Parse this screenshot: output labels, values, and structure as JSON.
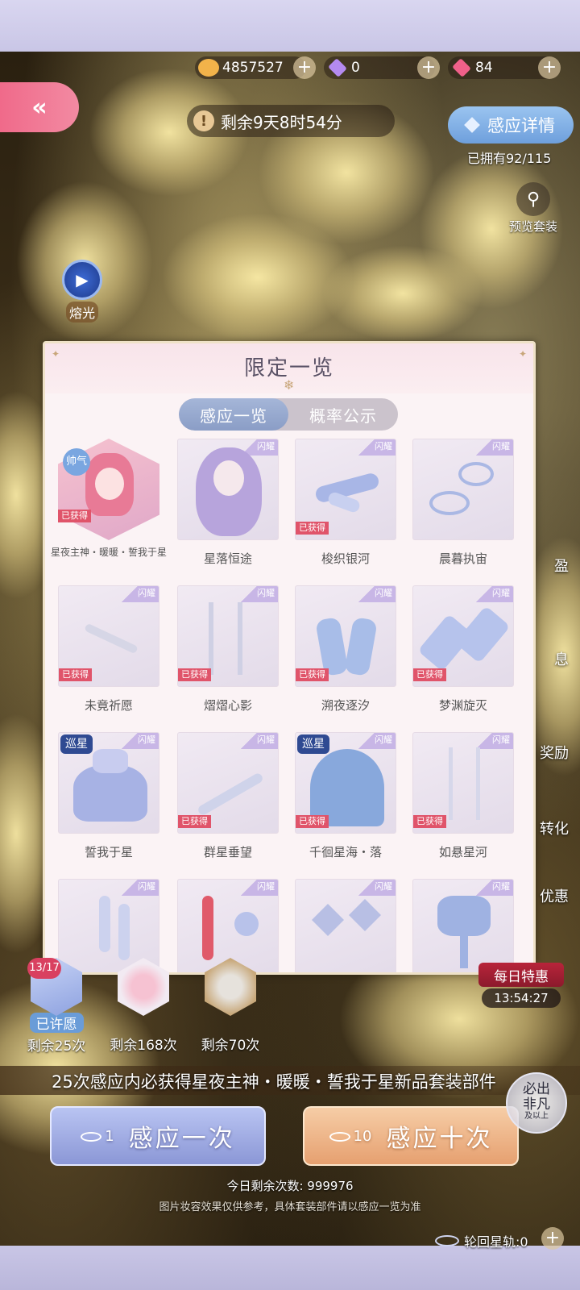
{
  "currency": {
    "gold": "4857527",
    "diamond": "0",
    "gem": "84",
    "gold_color": "#f2b34a",
    "diamond_color": "#b48af0",
    "gem_color": "#f0608a"
  },
  "header": {
    "back_label": "«",
    "timer_icon": "!",
    "timer": "剩余9天8时54分",
    "detail_button": "感应详情",
    "owned": "已拥有92/115",
    "preview_label": "预览套装",
    "play_label": "熔光"
  },
  "side_fragments": [
    "盈",
    "息",
    "奖励",
    "转化",
    "优惠"
  ],
  "panel": {
    "title": "限定一览",
    "tabs": [
      "感应一览",
      "概率公示"
    ],
    "corner_tag": "闪耀",
    "got_label": "已获得",
    "items": [
      {
        "name": "星夜主神・暖暖・誓我于星",
        "got": true,
        "special": true,
        "rarity": "帅气"
      },
      {
        "name": "星落恒途",
        "got": false
      },
      {
        "name": "梭织银河",
        "got": true
      },
      {
        "name": "晨暮执宙",
        "got": false
      },
      {
        "name": "未竟祈愿",
        "got": true
      },
      {
        "name": "熠熠心影",
        "got": true
      },
      {
        "name": "溯夜逐汐",
        "got": true
      },
      {
        "name": "梦渊旋灭",
        "got": true
      },
      {
        "name": "誓我于星",
        "got": false,
        "rarity": "巡星"
      },
      {
        "name": "群星垂望",
        "got": true
      },
      {
        "name": "千徊星海・落",
        "got": true,
        "rarity": "巡星"
      },
      {
        "name": "如悬星河",
        "got": true
      },
      {
        "name": "",
        "got": false
      },
      {
        "name": "",
        "got": false
      },
      {
        "name": "",
        "got": false
      },
      {
        "name": "",
        "got": false
      }
    ]
  },
  "pools": [
    {
      "badge": "13/17",
      "wished": "已许愿",
      "count": "剩余25次"
    },
    {
      "count": "剩余168次"
    },
    {
      "count": "剩余70次"
    }
  ],
  "daily": {
    "label": "每日特惠",
    "time": "13:54:27"
  },
  "guarantee": "25次感应内必获得星夜主神・暖暖・誓我于星新品套装部件",
  "buttons": {
    "once_cost": "1",
    "once_label": "感应一次",
    "ten_cost": "10",
    "ten_label": "感应十次"
  },
  "stamp": {
    "line1": "必出",
    "line2": "非凡",
    "line3": "及以上"
  },
  "remaining": "今日剩余次数: 999976",
  "disclaimer": "图片妆容效果仅供参考，具体套装部件请以感应一览为准",
  "star_track": "轮回星轨:0"
}
